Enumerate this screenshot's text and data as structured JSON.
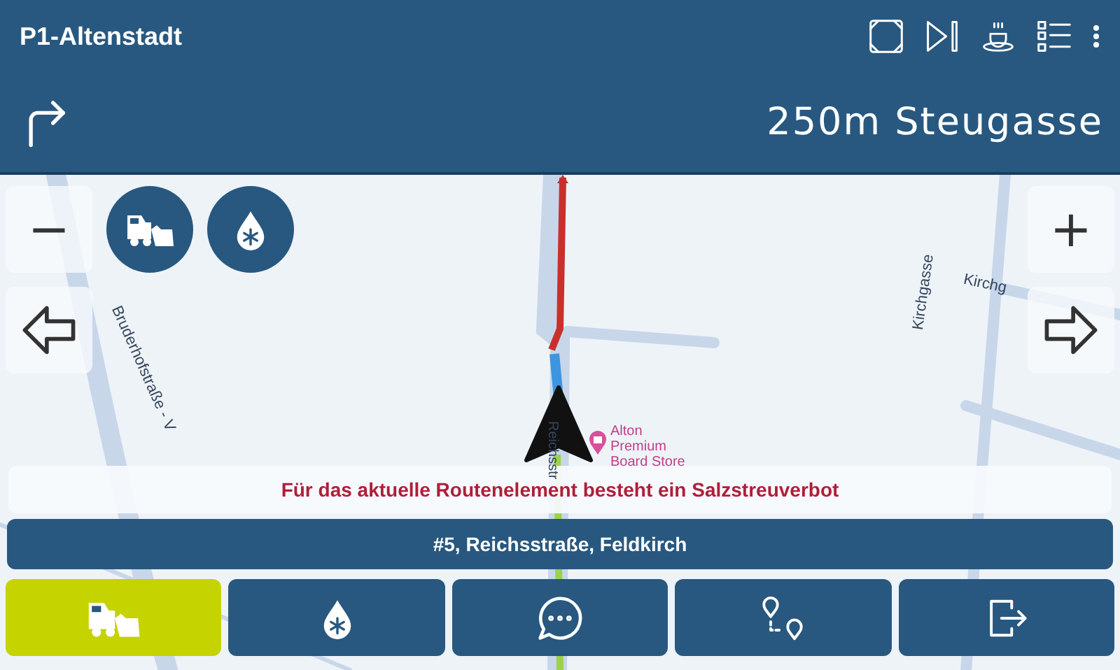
{
  "app_bar": {
    "title": "P1-Altenstadt",
    "actions": [
      {
        "kind": "fullscreen"
      },
      {
        "kind": "skip"
      },
      {
        "kind": "coffee"
      },
      {
        "kind": "list"
      },
      {
        "kind": "more"
      }
    ]
  },
  "instruction": {
    "kind": "turn-right",
    "distance": "250m",
    "street": "Steugasse"
  },
  "map": {
    "labels": [
      {
        "text": "Bruderhofstraße - V",
        "kind": "street-left"
      },
      {
        "text": "Kirchgasse",
        "kind": "street-right"
      },
      {
        "text": "Kirchg",
        "kind": "street-top-right"
      },
      {
        "text": "Reichsstr",
        "kind": "street-center"
      },
      {
        "text": "Alton Premium Board Store",
        "kind": "poi"
      }
    ],
    "zoom_out": "−",
    "zoom_in": "+",
    "quick_actions": [
      {
        "kind": "plow"
      },
      {
        "kind": "salt"
      }
    ]
  },
  "warning": "Für das aktuelle Routenelement besteht ein Salzstreuverbot",
  "route_element": "#5, Reichsstraße, Feldkirch",
  "toolbar": [
    {
      "kind": "plow",
      "selected": true
    },
    {
      "kind": "salt",
      "selected": false
    },
    {
      "kind": "chat",
      "selected": false
    },
    {
      "kind": "route",
      "selected": false
    },
    {
      "kind": "exit",
      "selected": false
    }
  ]
}
